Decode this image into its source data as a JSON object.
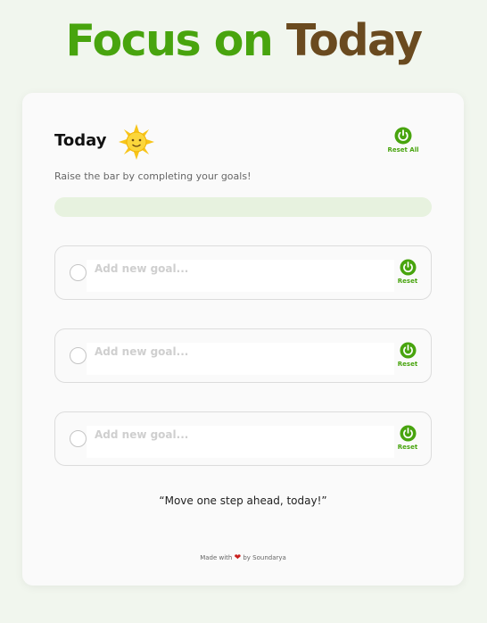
{
  "header": {
    "title_word_1": "Focus on",
    "title_word_2": "Today"
  },
  "colors": {
    "accent_green": "#48a40e",
    "title_brown": "#6a4a1f",
    "progress_track": "#e7f2df",
    "sun_yellow": "#f7c51b"
  },
  "card": {
    "heading": "Today",
    "heading_icon": "sun-icon",
    "reset_all_label": "Reset All",
    "reset_all_icon": "power-reset-icon",
    "subtitle": "Raise the bar by completing your goals!",
    "progress": 0
  },
  "goals": [
    {
      "value": "",
      "placeholder": "Add new goal...",
      "reset_label": "Reset",
      "completed": false
    },
    {
      "value": "",
      "placeholder": "Add new goal...",
      "reset_label": "Reset",
      "completed": false
    },
    {
      "value": "",
      "placeholder": "Add new goal...",
      "reset_label": "Reset",
      "completed": false
    }
  ],
  "quote": "“Move one step ahead, today!”",
  "footer": {
    "made_with": "Made with",
    "heart_icon": "heart-icon",
    "author": "by Soundarya"
  }
}
